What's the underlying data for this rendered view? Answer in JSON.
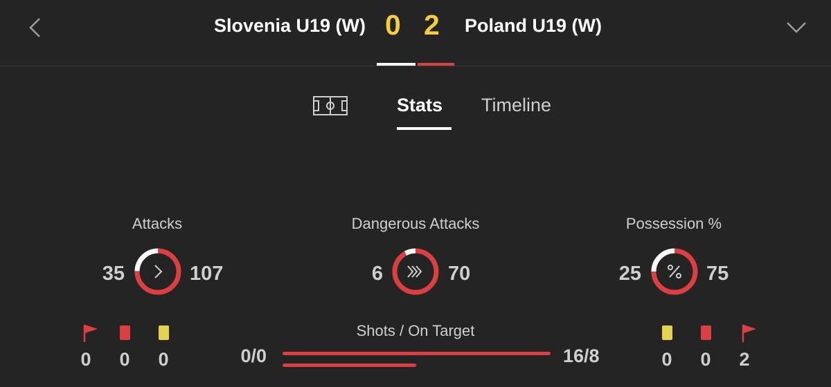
{
  "header": {
    "home_team": "Slovenia U19 (W)",
    "away_team": "Poland U19 (W)",
    "home_score": "0",
    "away_score": "2"
  },
  "tabs": {
    "pitch_icon": "pitch-icon",
    "stats": "Stats",
    "timeline": "Timeline",
    "active": "Stats"
  },
  "stats": {
    "attacks": {
      "title": "Attacks",
      "home": "35",
      "away": "107",
      "icon": "chevron-right-icon"
    },
    "dangerous_attacks": {
      "title": "Dangerous Attacks",
      "home": "6",
      "away": "70",
      "icon": "double-chevron-icon"
    },
    "possession": {
      "title": "Possession %",
      "home": "25",
      "away": "75",
      "icon": "percent-icon"
    }
  },
  "home_discipline": {
    "corners": "0",
    "red_cards": "0",
    "yellow_cards": "0"
  },
  "away_discipline": {
    "yellow_cards": "0",
    "red_cards": "0",
    "corners": "2"
  },
  "shots": {
    "title": "Shots / On Target",
    "home": "0/0",
    "away": "16/8"
  },
  "colors": {
    "background": "#242425",
    "score": "#f2cd40",
    "away_red": "#dc3f42",
    "home_white": "#ffffff",
    "yellow_card": "#e3d34f",
    "red_card": "#dc3f42"
  }
}
